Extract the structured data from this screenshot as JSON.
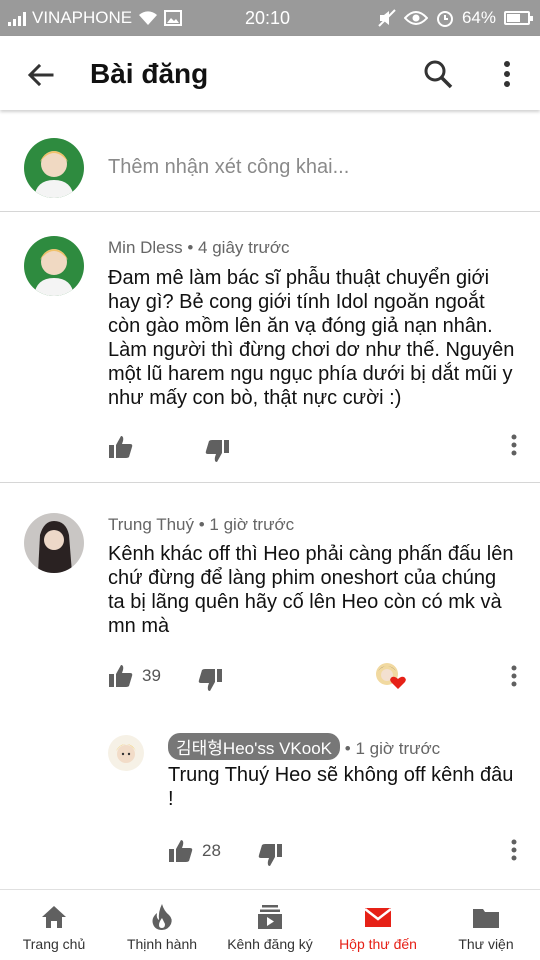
{
  "status_bar": {
    "carrier": "VINAPHONE",
    "time": "20:10",
    "battery_percent": "64%",
    "battery_level": 0.64
  },
  "app_bar": {
    "title": "Bài đăng",
    "back_icon": "arrow-back-icon",
    "search_icon": "search-icon",
    "more_icon": "more-vert-icon"
  },
  "add_comment": {
    "placeholder": "Thêm nhận xét công khai..."
  },
  "comments": [
    {
      "author": "Min Dless",
      "time": "4 giây trước",
      "text": "Đam mê làm bác sĩ phẫu thuật chuyển giới hay gì? Bẻ cong giới tính Idol ngoăn ngoắt còn gào mồm lên ăn vạ đóng giả nạn nhân. Làm người thì đừng chơi dơ như thế. Nguyên một lũ harem ngu ngục phía dưới bị dắt mũi y như mấy con bò, thật nực cười :)",
      "likes": ""
    },
    {
      "author": "Trung Thuý",
      "time": "1 giờ trước",
      "text": "Kênh khác off thì Heo phải càng phấn đấu lên chứ đừng để làng phim oneshort của chúng ta bị lãng quên hãy cố lên Heo còn có mk và mn mà",
      "likes": "39"
    }
  ],
  "reply": {
    "author": "김태형Heo'ss VKooK",
    "time": "1 giờ trước",
    "text": "Trung Thuý Heo sẽ không off kênh đâu !",
    "likes": "28"
  },
  "meta_separator": "•",
  "bottom_nav": [
    {
      "label": "Trang chủ",
      "icon": "home-icon"
    },
    {
      "label": "Thịnh hành",
      "icon": "trending-icon"
    },
    {
      "label": "Kênh đăng ký",
      "icon": "subscriptions-icon"
    },
    {
      "label": "Hộp thư đến",
      "icon": "inbox-icon",
      "active": true
    },
    {
      "label": "Thư viện",
      "icon": "library-icon"
    }
  ],
  "colors": {
    "accent": "#e62117",
    "status_bar": "#9a9a9a",
    "icon": "#606060"
  }
}
